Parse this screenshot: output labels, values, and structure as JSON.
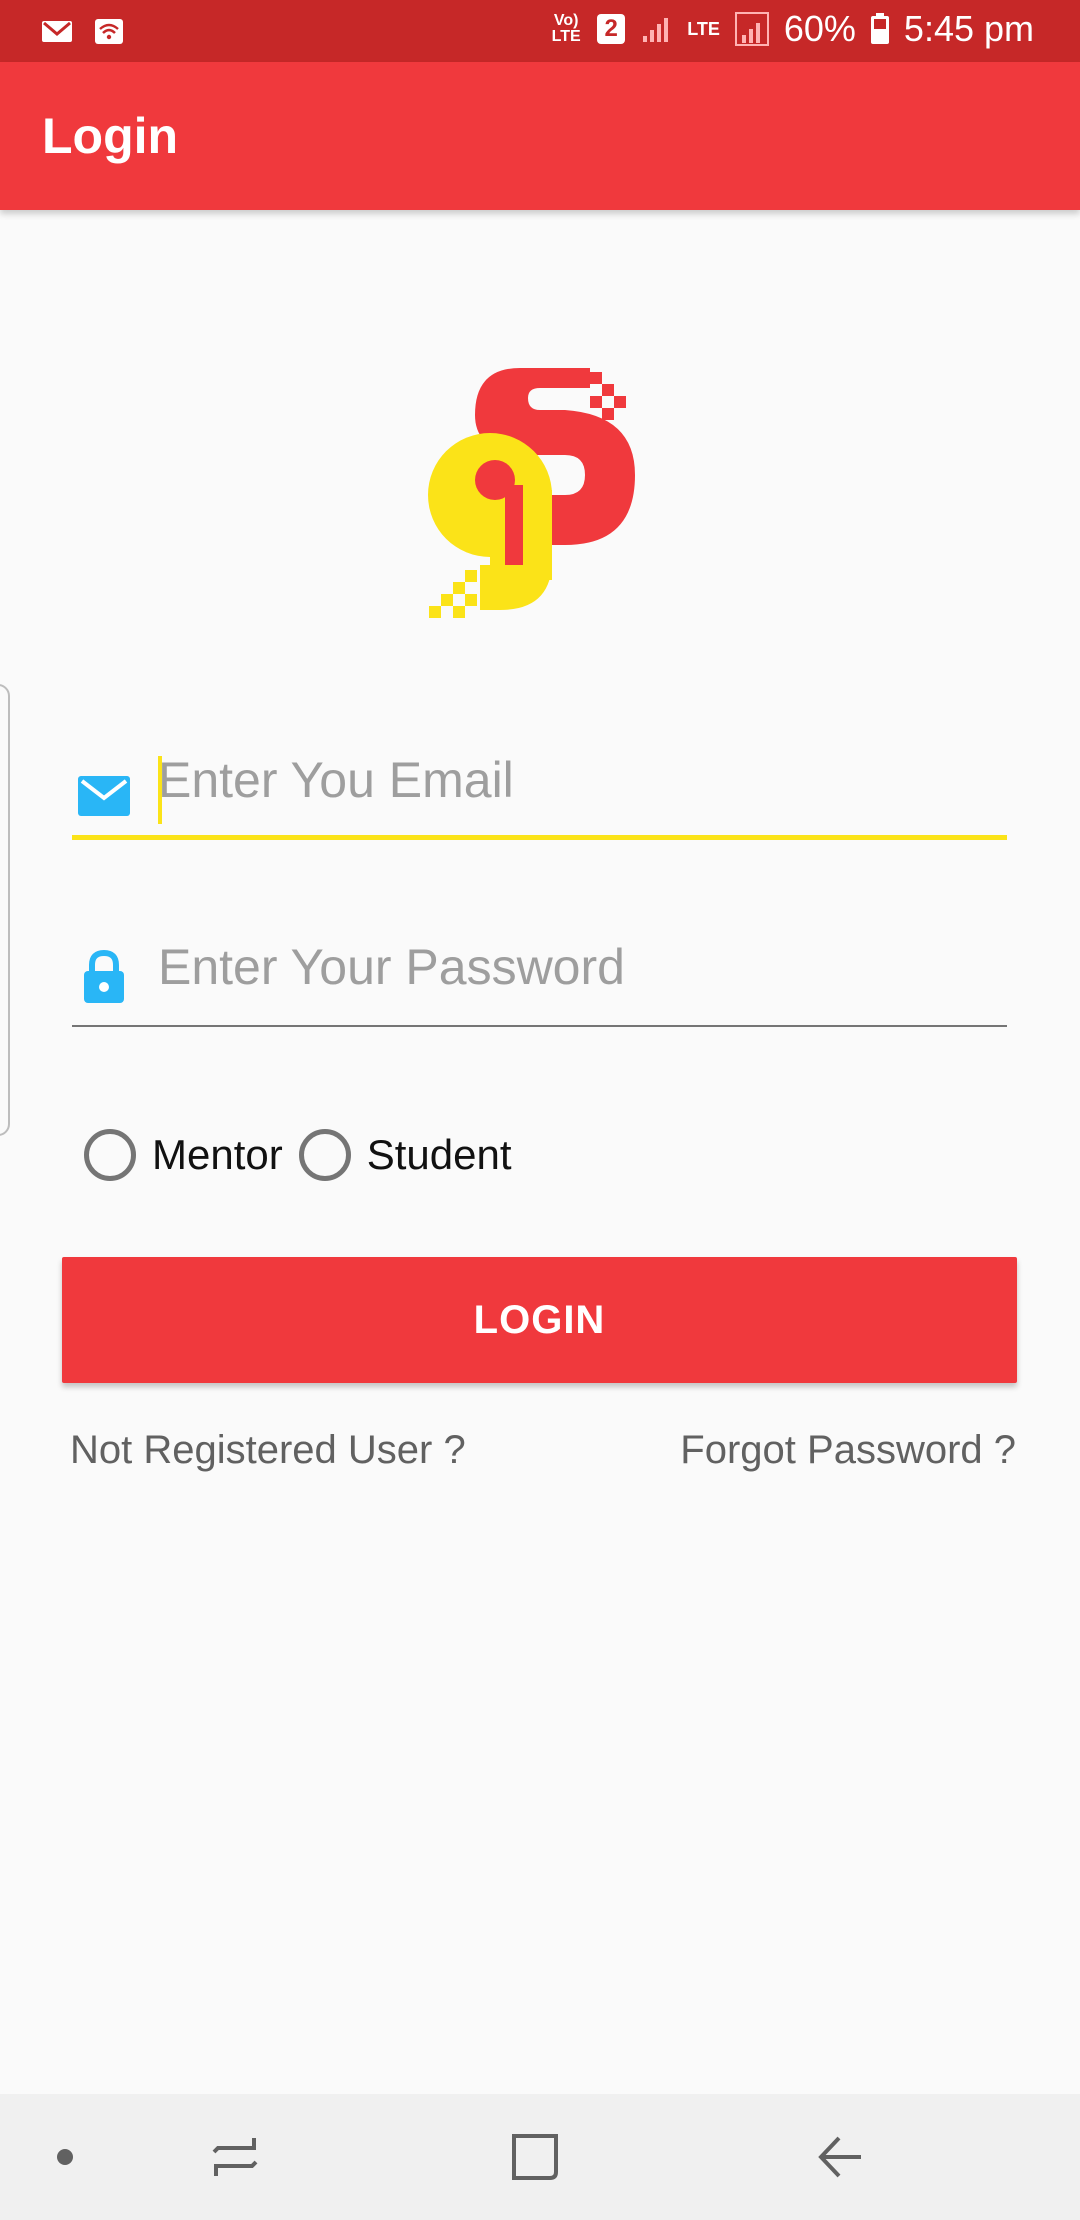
{
  "status_bar": {
    "left_icons": [
      "gmail-icon",
      "wifi-hotspot-icon"
    ],
    "volte_label": "Vo) LTE",
    "sim_badge": "2",
    "network_type": "LTE",
    "battery_percent": "60%",
    "time": "5:45 pm"
  },
  "app_bar": {
    "title": "Login"
  },
  "logo": {
    "name": "gs-logo",
    "colors": {
      "red": "#f0393d",
      "yellow": "#fbe318"
    }
  },
  "form": {
    "email": {
      "placeholder": "Enter You Email",
      "value": "",
      "icon": "mail-icon",
      "focused": true
    },
    "password": {
      "placeholder": "Enter Your Password",
      "value": "",
      "icon": "lock-icon"
    },
    "roles": [
      {
        "label": "Mentor",
        "selected": false
      },
      {
        "label": "Student",
        "selected": false
      }
    ],
    "login_label": "LOGIN"
  },
  "links": {
    "not_registered": "Not Registered User ?",
    "forgot_password": "Forgot Password ?"
  },
  "nav_bar": {
    "items": [
      "dot-icon",
      "recent-apps-icon",
      "home-icon",
      "back-icon"
    ]
  },
  "colors": {
    "primary": "#f0393d",
    "status_bar": "#c62828",
    "accent_yellow": "#fbe318",
    "icon_blue": "#29b6f6",
    "background": "#fafafa"
  }
}
